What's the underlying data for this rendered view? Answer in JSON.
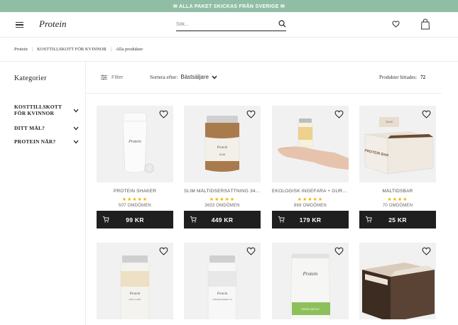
{
  "announcement": "✉ ALLA PAKET SKICKAS FRÅN SVERIGE ✉",
  "header": {
    "logo_text": "Protein",
    "search_placeholder": "Sök..."
  },
  "breadcrumb": [
    "Protein",
    "KOSTTILLSKOTT FÖR KVINNOR",
    "Alla produkter"
  ],
  "sidebar": {
    "title": "Kategorier",
    "categories": [
      {
        "label": "KOSTTILLSKOTT FÖR KVINNOR"
      },
      {
        "label": "DITT MÅL?"
      },
      {
        "label": "PROTEIN NÄR?"
      }
    ]
  },
  "toolbar": {
    "filter_label": "Filter",
    "sort_label": "Sortera efter:",
    "sort_value": "Bästsäljare",
    "count_label": "Produkter hittades:",
    "count_value": "72"
  },
  "products": [
    {
      "name": "PROTEIN SHAKER",
      "rating": 5,
      "stars": "★★★★★",
      "reviews": "507 OMDÖMEN",
      "price": "99 KR"
    },
    {
      "name": "SLIM MÅLTIDSERSÄTTNING 34 M...",
      "rating": 5,
      "stars": "★★★★★",
      "reviews": "3633 OMDÖMEN",
      "price": "449 KR"
    },
    {
      "name": "EKOLOGISK INGEFÄRA + GURKM...",
      "rating": 5,
      "stars": "★★★★★",
      "reviews": "869 OMDÖMEN",
      "price": "179 KR"
    },
    {
      "name": "MÅLTIDSBAR",
      "rating": 4,
      "stars": "★★★★",
      "reviews": "70 OMDÖMEN",
      "price": "25 KR"
    }
  ],
  "product_labels": {
    "slim": "SLIM",
    "bar_slim": "SLIM",
    "bar_text": "PROTEIN BAR",
    "jar4_text": "SKIN & HAIR",
    "jar5_text": "TRÄNINGSVERKTYG",
    "bag_text": "GREEN DETOX",
    "colors": {
      "accent_bar": "#8fbea4",
      "button": "#1f1f1f",
      "stars": "#f4b400"
    }
  }
}
